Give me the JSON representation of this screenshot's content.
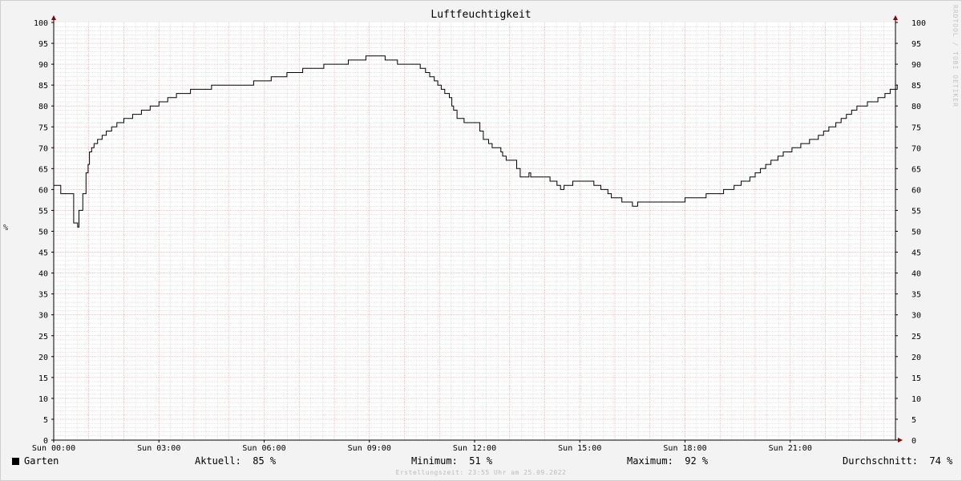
{
  "chart_data": {
    "type": "line",
    "title": "Luftfeuchtigkeit",
    "ylabel": "%",
    "ylim": [
      0,
      100
    ],
    "yticks": [
      0,
      5,
      10,
      15,
      20,
      25,
      30,
      35,
      40,
      45,
      50,
      55,
      60,
      65,
      70,
      75,
      80,
      85,
      90,
      95,
      100
    ],
    "xlim": [
      0,
      24
    ],
    "xticks": [
      {
        "hour": 0,
        "label": "Sun 00:00"
      },
      {
        "hour": 3,
        "label": "Sun 03:00"
      },
      {
        "hour": 6,
        "label": "Sun 06:00"
      },
      {
        "hour": 9,
        "label": "Sun 09:00"
      },
      {
        "hour": 12,
        "label": "Sun 12:00"
      },
      {
        "hour": 15,
        "label": "Sun 15:00"
      },
      {
        "hour": 18,
        "label": "Sun 18:00"
      },
      {
        "hour": 21,
        "label": "Sun 21:00"
      }
    ],
    "grid": true,
    "series": [
      {
        "name": "Garten",
        "color": "#000000",
        "points": [
          [
            0,
            61
          ],
          [
            0.15,
            61
          ],
          [
            0.2,
            59
          ],
          [
            0.35,
            59
          ],
          [
            0.55,
            59
          ],
          [
            0.57,
            52
          ],
          [
            0.65,
            52
          ],
          [
            0.68,
            51
          ],
          [
            0.72,
            55
          ],
          [
            0.8,
            55
          ],
          [
            0.83,
            59
          ],
          [
            0.88,
            59
          ],
          [
            0.92,
            64
          ],
          [
            0.98,
            66
          ],
          [
            1.02,
            69
          ],
          [
            1.08,
            70
          ],
          [
            1.15,
            71
          ],
          [
            1.25,
            72
          ],
          [
            1.38,
            73
          ],
          [
            1.5,
            74
          ],
          [
            1.65,
            75
          ],
          [
            1.8,
            76
          ],
          [
            2.0,
            77
          ],
          [
            2.25,
            78
          ],
          [
            2.5,
            79
          ],
          [
            2.75,
            80
          ],
          [
            3.0,
            81
          ],
          [
            3.25,
            82
          ],
          [
            3.5,
            83
          ],
          [
            3.9,
            84
          ],
          [
            4.5,
            85
          ],
          [
            5.7,
            86
          ],
          [
            6.2,
            87
          ],
          [
            6.65,
            88
          ],
          [
            7.1,
            89
          ],
          [
            7.7,
            90
          ],
          [
            8.4,
            91
          ],
          [
            8.9,
            92
          ],
          [
            9.35,
            92
          ],
          [
            9.45,
            91
          ],
          [
            9.8,
            90
          ],
          [
            10.3,
            90
          ],
          [
            10.45,
            89
          ],
          [
            10.6,
            88
          ],
          [
            10.72,
            87
          ],
          [
            10.85,
            86
          ],
          [
            10.95,
            85
          ],
          [
            11.05,
            84
          ],
          [
            11.15,
            83
          ],
          [
            11.28,
            82
          ],
          [
            11.35,
            80
          ],
          [
            11.4,
            79
          ],
          [
            11.5,
            77
          ],
          [
            11.7,
            76
          ],
          [
            12.1,
            76
          ],
          [
            12.15,
            74
          ],
          [
            12.25,
            72
          ],
          [
            12.4,
            71
          ],
          [
            12.5,
            70
          ],
          [
            12.75,
            69
          ],
          [
            12.8,
            68
          ],
          [
            12.9,
            67
          ],
          [
            13.2,
            65
          ],
          [
            13.3,
            63
          ],
          [
            13.5,
            63
          ],
          [
            13.55,
            64
          ],
          [
            13.6,
            63
          ],
          [
            14.0,
            63
          ],
          [
            14.15,
            62
          ],
          [
            14.35,
            61
          ],
          [
            14.45,
            60
          ],
          [
            14.55,
            61
          ],
          [
            14.8,
            62
          ],
          [
            15.2,
            62
          ],
          [
            15.4,
            61
          ],
          [
            15.6,
            60
          ],
          [
            15.8,
            59
          ],
          [
            15.9,
            58
          ],
          [
            16.2,
            57
          ],
          [
            16.5,
            56
          ],
          [
            16.65,
            57
          ],
          [
            17.15,
            57
          ],
          [
            17.7,
            57
          ],
          [
            18.0,
            58
          ],
          [
            18.6,
            59
          ],
          [
            19.1,
            60
          ],
          [
            19.4,
            61
          ],
          [
            19.6,
            62
          ],
          [
            19.85,
            63
          ],
          [
            20.0,
            64
          ],
          [
            20.15,
            65
          ],
          [
            20.3,
            66
          ],
          [
            20.45,
            67
          ],
          [
            20.65,
            68
          ],
          [
            20.8,
            69
          ],
          [
            21.05,
            70
          ],
          [
            21.3,
            71
          ],
          [
            21.55,
            72
          ],
          [
            21.8,
            73
          ],
          [
            21.95,
            74
          ],
          [
            22.1,
            75
          ],
          [
            22.3,
            76
          ],
          [
            22.45,
            77
          ],
          [
            22.6,
            78
          ],
          [
            22.75,
            79
          ],
          [
            22.9,
            80
          ],
          [
            23.2,
            81
          ],
          [
            23.5,
            82
          ],
          [
            23.7,
            83
          ],
          [
            23.85,
            84
          ],
          [
            24.0,
            84
          ],
          [
            24.05,
            85
          ]
        ]
      }
    ]
  },
  "legend": {
    "series_name": "Garten",
    "current_label": "Aktuell:",
    "current_value": "85 %",
    "min_label": "Minimum:",
    "min_value": "51 %",
    "max_label": "Maximum:",
    "max_value": "92 %",
    "avg_label": "Durchschnitt:",
    "avg_value": "74 %"
  },
  "watermark": "RRDTOOL / TOBI OETIKER",
  "footer": "Erstellungszeit: 23:55 Uhr am 25.09.2022",
  "colors": {
    "minor_grid": "#c8c8c8",
    "major_grid": "#e8a0a0",
    "axis": "#000000",
    "arrow": "#8b0000",
    "plot_bg": "#ffffff",
    "page_bg": "#f3f3f3"
  }
}
